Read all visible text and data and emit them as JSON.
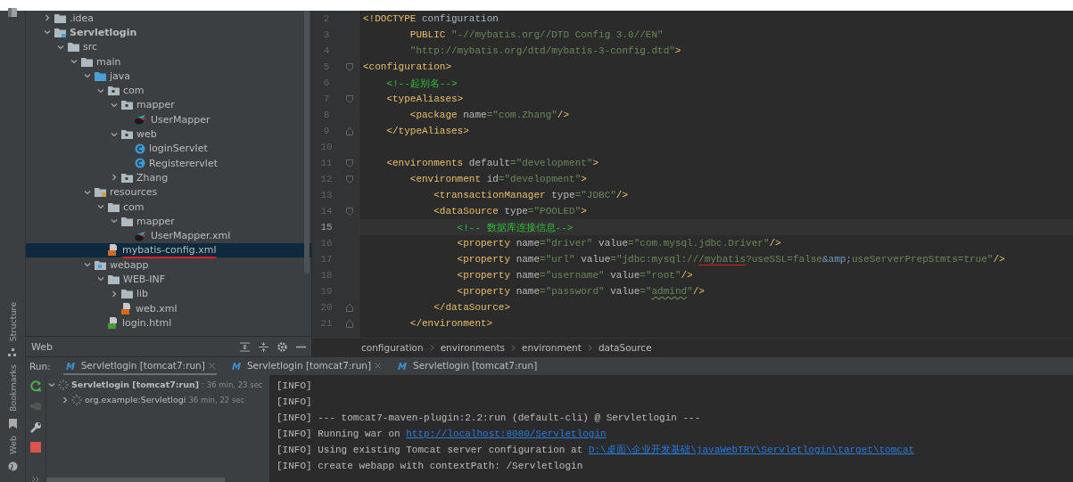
{
  "left_strip": {
    "labels": [
      "Structure",
      "Bookmarks",
      "Web"
    ]
  },
  "project_tree": [
    {
      "label": ".idea",
      "kind": "folder",
      "expanded": false,
      "selected": false
    },
    {
      "label": "Servletlogin",
      "kind": "module",
      "expanded": true,
      "bold": true,
      "selected": false,
      "children": [
        {
          "label": "src",
          "kind": "folder",
          "expanded": true,
          "selected": false,
          "children": [
            {
              "label": "main",
              "kind": "folder",
              "expanded": true,
              "selected": false,
              "children": [
                {
                  "label": "java",
                  "kind": "source-folder",
                  "expanded": true,
                  "selected": false,
                  "children": [
                    {
                      "label": "com",
                      "kind": "package",
                      "expanded": true,
                      "selected": false,
                      "children": [
                        {
                          "label": "mapper",
                          "kind": "package",
                          "expanded": true,
                          "selected": false,
                          "children": [
                            {
                              "label": "UserMapper",
                              "kind": "mapper",
                              "selected": false
                            }
                          ]
                        },
                        {
                          "label": "web",
                          "kind": "package",
                          "expanded": true,
                          "selected": false,
                          "children": [
                            {
                              "label": "loginServlet",
                              "kind": "class",
                              "selected": false
                            },
                            {
                              "label": "Registerervlet",
                              "kind": "class",
                              "selected": false
                            }
                          ]
                        },
                        {
                          "label": "Zhang",
                          "kind": "package",
                          "expanded": false,
                          "selected": false
                        }
                      ]
                    }
                  ]
                },
                {
                  "label": "resources",
                  "kind": "resource-folder",
                  "expanded": true,
                  "selected": false,
                  "children": [
                    {
                      "label": "com",
                      "kind": "folder",
                      "expanded": true,
                      "selected": false,
                      "children": [
                        {
                          "label": "mapper",
                          "kind": "folder",
                          "expanded": true,
                          "selected": false,
                          "children": [
                            {
                              "label": "UserMapper.xml",
                              "kind": "mapper",
                              "selected": false
                            }
                          ]
                        }
                      ]
                    },
                    {
                      "label": "mybatis-config.xml",
                      "kind": "xml",
                      "selected": true,
                      "marked": true
                    }
                  ]
                },
                {
                  "label": "webapp",
                  "kind": "web-folder",
                  "expanded": true,
                  "selected": false,
                  "children": [
                    {
                      "label": "WEB-INF",
                      "kind": "folder",
                      "expanded": true,
                      "selected": false,
                      "children": [
                        {
                          "label": "lib",
                          "kind": "folder",
                          "expanded": false,
                          "selected": false
                        },
                        {
                          "label": "web.xml",
                          "kind": "xml",
                          "selected": false
                        }
                      ]
                    },
                    {
                      "label": "login.html",
                      "kind": "html",
                      "selected": false
                    }
                  ]
                }
              ]
            }
          ]
        }
      ]
    }
  ],
  "web_panel": {
    "title": "Web"
  },
  "editor": {
    "lines": [
      {
        "number": "2",
        "current": false,
        "tokens": [
          {
            "kind": "tag",
            "text": "<!DOCTYPE "
          },
          {
            "kind": "text",
            "text": "configuration"
          }
        ]
      },
      {
        "number": "3",
        "current": false,
        "tokens": [
          {
            "kind": "tag",
            "text": "        PUBLIC "
          },
          {
            "kind": "value",
            "text": "\"-//mybatis.org//DTD Config 3.0//EN\""
          }
        ]
      },
      {
        "number": "4",
        "current": false,
        "tokens": [
          {
            "kind": "value",
            "text": "        \"http://mybatis.org/dtd/mybatis-3-config.dtd\""
          },
          {
            "kind": "tag",
            "text": ">"
          }
        ]
      },
      {
        "number": "5",
        "current": false,
        "kind": "fold-start",
        "tokens": [
          {
            "kind": "tag",
            "text": "<configuration>"
          }
        ]
      },
      {
        "number": "6",
        "current": false,
        "tokens": [
          {
            "kind": "comment",
            "text": "    <!--起别名-->"
          }
        ]
      },
      {
        "number": "7",
        "current": false,
        "kind": "fold-start",
        "tokens": [
          {
            "kind": "tag",
            "text": "    <typeAliases>"
          }
        ]
      },
      {
        "number": "8",
        "current": false,
        "tokens": [
          {
            "kind": "tag",
            "text": "        <package "
          },
          {
            "kind": "attr",
            "text": "name"
          },
          {
            "kind": "value",
            "text": "=\"com.Zhang\""
          },
          {
            "kind": "tag",
            "text": "/>"
          }
        ]
      },
      {
        "number": "9",
        "current": false,
        "kind": "fold-end",
        "tokens": [
          {
            "kind": "tag",
            "text": "    </typeAliases>"
          }
        ]
      },
      {
        "number": "10",
        "current": false
      },
      {
        "number": "11",
        "current": false,
        "kind": "fold-start",
        "tokens": [
          {
            "kind": "tag",
            "text": "    <environments "
          },
          {
            "kind": "attr",
            "text": "default"
          },
          {
            "kind": "value",
            "text": "=\"development\""
          },
          {
            "kind": "tag",
            "text": ">"
          }
        ]
      },
      {
        "number": "12",
        "current": false,
        "kind": "fold-start",
        "tokens": [
          {
            "kind": "tag",
            "text": "        <environment "
          },
          {
            "kind": "attr",
            "text": "id"
          },
          {
            "kind": "value",
            "text": "=\"development\""
          },
          {
            "kind": "tag",
            "text": ">"
          }
        ]
      },
      {
        "number": "13",
        "current": false,
        "tokens": [
          {
            "kind": "tag",
            "text": "            <transactionManager "
          },
          {
            "kind": "attr",
            "text": "type"
          },
          {
            "kind": "value",
            "text": "=\"JDBC\""
          },
          {
            "kind": "tag",
            "text": "/>"
          }
        ]
      },
      {
        "number": "14",
        "current": false,
        "kind": "fold-start",
        "tokens": [
          {
            "kind": "tag",
            "text": "            <dataSource "
          },
          {
            "kind": "attr",
            "text": "type"
          },
          {
            "kind": "value",
            "text": "=\"POOLED\""
          },
          {
            "kind": "tag",
            "text": ">"
          }
        ]
      },
      {
        "number": "15",
        "current": true,
        "tokens": [
          {
            "kind": "comment",
            "text": "                <!-- 数据库连接信息-->"
          }
        ]
      },
      {
        "number": "16",
        "current": false,
        "tokens": [
          {
            "kind": "tag",
            "text": "                <property "
          },
          {
            "kind": "attr",
            "text": "name"
          },
          {
            "kind": "value",
            "text": "=\"driver\" "
          },
          {
            "kind": "attr",
            "text": "value"
          },
          {
            "kind": "value",
            "text": "=\"com.mysql.jdbc.Driver\""
          },
          {
            "kind": "tag",
            "text": "/>"
          }
        ]
      },
      {
        "number": "17",
        "current": false,
        "tokens": [
          {
            "kind": "tag",
            "text": "                <property "
          },
          {
            "kind": "attr",
            "text": "name"
          },
          {
            "kind": "value",
            "text": "=\"url\" "
          },
          {
            "kind": "attr",
            "text": "value"
          },
          {
            "kind": "value",
            "text": "=\"jdbc:mysql://"
          },
          {
            "kind": "value-marked",
            "text": "/mybatis"
          },
          {
            "kind": "value",
            "text": "?useSSL=false"
          },
          {
            "kind": "entity",
            "text": "&amp;"
          },
          {
            "kind": "value",
            "text": "useServerPrepStmts=true\""
          },
          {
            "kind": "tag",
            "text": "/>"
          }
        ]
      },
      {
        "number": "18",
        "current": false,
        "tokens": [
          {
            "kind": "tag",
            "text": "                <property "
          },
          {
            "kind": "attr",
            "text": "name"
          },
          {
            "kind": "value",
            "text": "=\"username\" "
          },
          {
            "kind": "attr",
            "text": "value"
          },
          {
            "kind": "value",
            "text": "=\"root\""
          },
          {
            "kind": "tag",
            "text": "/>"
          }
        ]
      },
      {
        "number": "19",
        "current": false,
        "tokens": [
          {
            "kind": "tag",
            "text": "                <property "
          },
          {
            "kind": "attr",
            "text": "name"
          },
          {
            "kind": "value",
            "text": "=\"password\" "
          },
          {
            "kind": "attr",
            "text": "value"
          },
          {
            "kind": "value",
            "text": "=\""
          },
          {
            "kind": "value-typo",
            "text": "admind"
          },
          {
            "kind": "value",
            "text": "\""
          },
          {
            "kind": "tag",
            "text": "/>"
          }
        ]
      },
      {
        "number": "20",
        "current": false,
        "kind": "fold-end",
        "tokens": [
          {
            "kind": "tag",
            "text": "            </dataSource>"
          }
        ]
      },
      {
        "number": "21",
        "current": false,
        "kind": "fold-end",
        "tokens": [
          {
            "kind": "tag",
            "text": "        </environment>"
          }
        ]
      }
    ]
  },
  "breadcrumbs": [
    "configuration",
    "environments",
    "environment",
    "dataSource"
  ],
  "run_panel": {
    "label": "Run:",
    "tabs": [
      {
        "label": "Servletlogin [tomcat7:run]",
        "selected": true,
        "closable": true
      },
      {
        "label": "Servletlogin [tomcat7:run]",
        "selected": false,
        "closable": true
      },
      {
        "label": "Servletlogin [tomcat7:run]",
        "selected": false,
        "closable": false
      }
    ],
    "tree": [
      {
        "label": "Servletlogin [tomcat7:run]",
        "time": ": 36 min, 23 sec",
        "expanded": true,
        "bold": true
      },
      {
        "label": "org.example:Servletlogi",
        "time": "36 min, 22 sec",
        "expanded": false,
        "bold": false
      }
    ],
    "console": [
      [
        {
          "kind": "text",
          "text": "[INFO]"
        }
      ],
      [
        {
          "kind": "text",
          "text": "[INFO]"
        }
      ],
      [
        {
          "kind": "text",
          "text": "[INFO] --- tomcat7-maven-plugin:2.2:run (default-cli) @ Servletlogin ---"
        }
      ],
      [
        {
          "kind": "text",
          "text": "[INFO] Running war on "
        },
        {
          "kind": "link",
          "text": "http://localhost:8080/Servletlogin"
        }
      ],
      [
        {
          "kind": "text",
          "text": "[INFO] Using existing Tomcat server configuration at "
        },
        {
          "kind": "link",
          "text": "D:\\桌面\\企业开发基础\\javaWebTRY\\Servletlogin\\target\\tomcat"
        }
      ],
      [
        {
          "kind": "text",
          "text": "[INFO] create webapp with contextPath: /Servletlogin"
        }
      ]
    ]
  }
}
